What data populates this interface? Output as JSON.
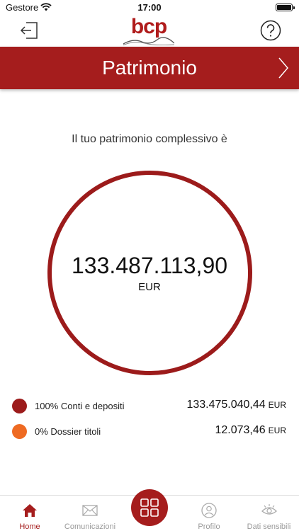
{
  "status_bar": {
    "carrier": "Gestore",
    "time": "17:00"
  },
  "header": {
    "logo_text": "bcp",
    "title": "Patrimonio"
  },
  "summary": {
    "label": "Il tuo patrimonio complessivo è",
    "total_amount": "133.487.113,90",
    "currency": "EUR"
  },
  "breakdown": [
    {
      "label": "100% Conti e depositi",
      "amount": "133.475.040,44",
      "currency": "EUR",
      "color": "#9c1b1b"
    },
    {
      "label": "0% Dossier titoli",
      "amount": "12.073,46",
      "currency": "EUR",
      "color": "#ee6a22"
    }
  ],
  "tabs": [
    {
      "label": "Home",
      "icon": "home-icon",
      "active": true
    },
    {
      "label": "Comunicazioni",
      "icon": "mail-icon",
      "active": false
    },
    {
      "label": "Profilo",
      "icon": "profile-icon",
      "active": false
    },
    {
      "label": "Dati sensibili",
      "icon": "eye-icon",
      "active": false
    }
  ],
  "colors": {
    "brand": "#a51d1d",
    "inactive_tab": "#999999"
  }
}
